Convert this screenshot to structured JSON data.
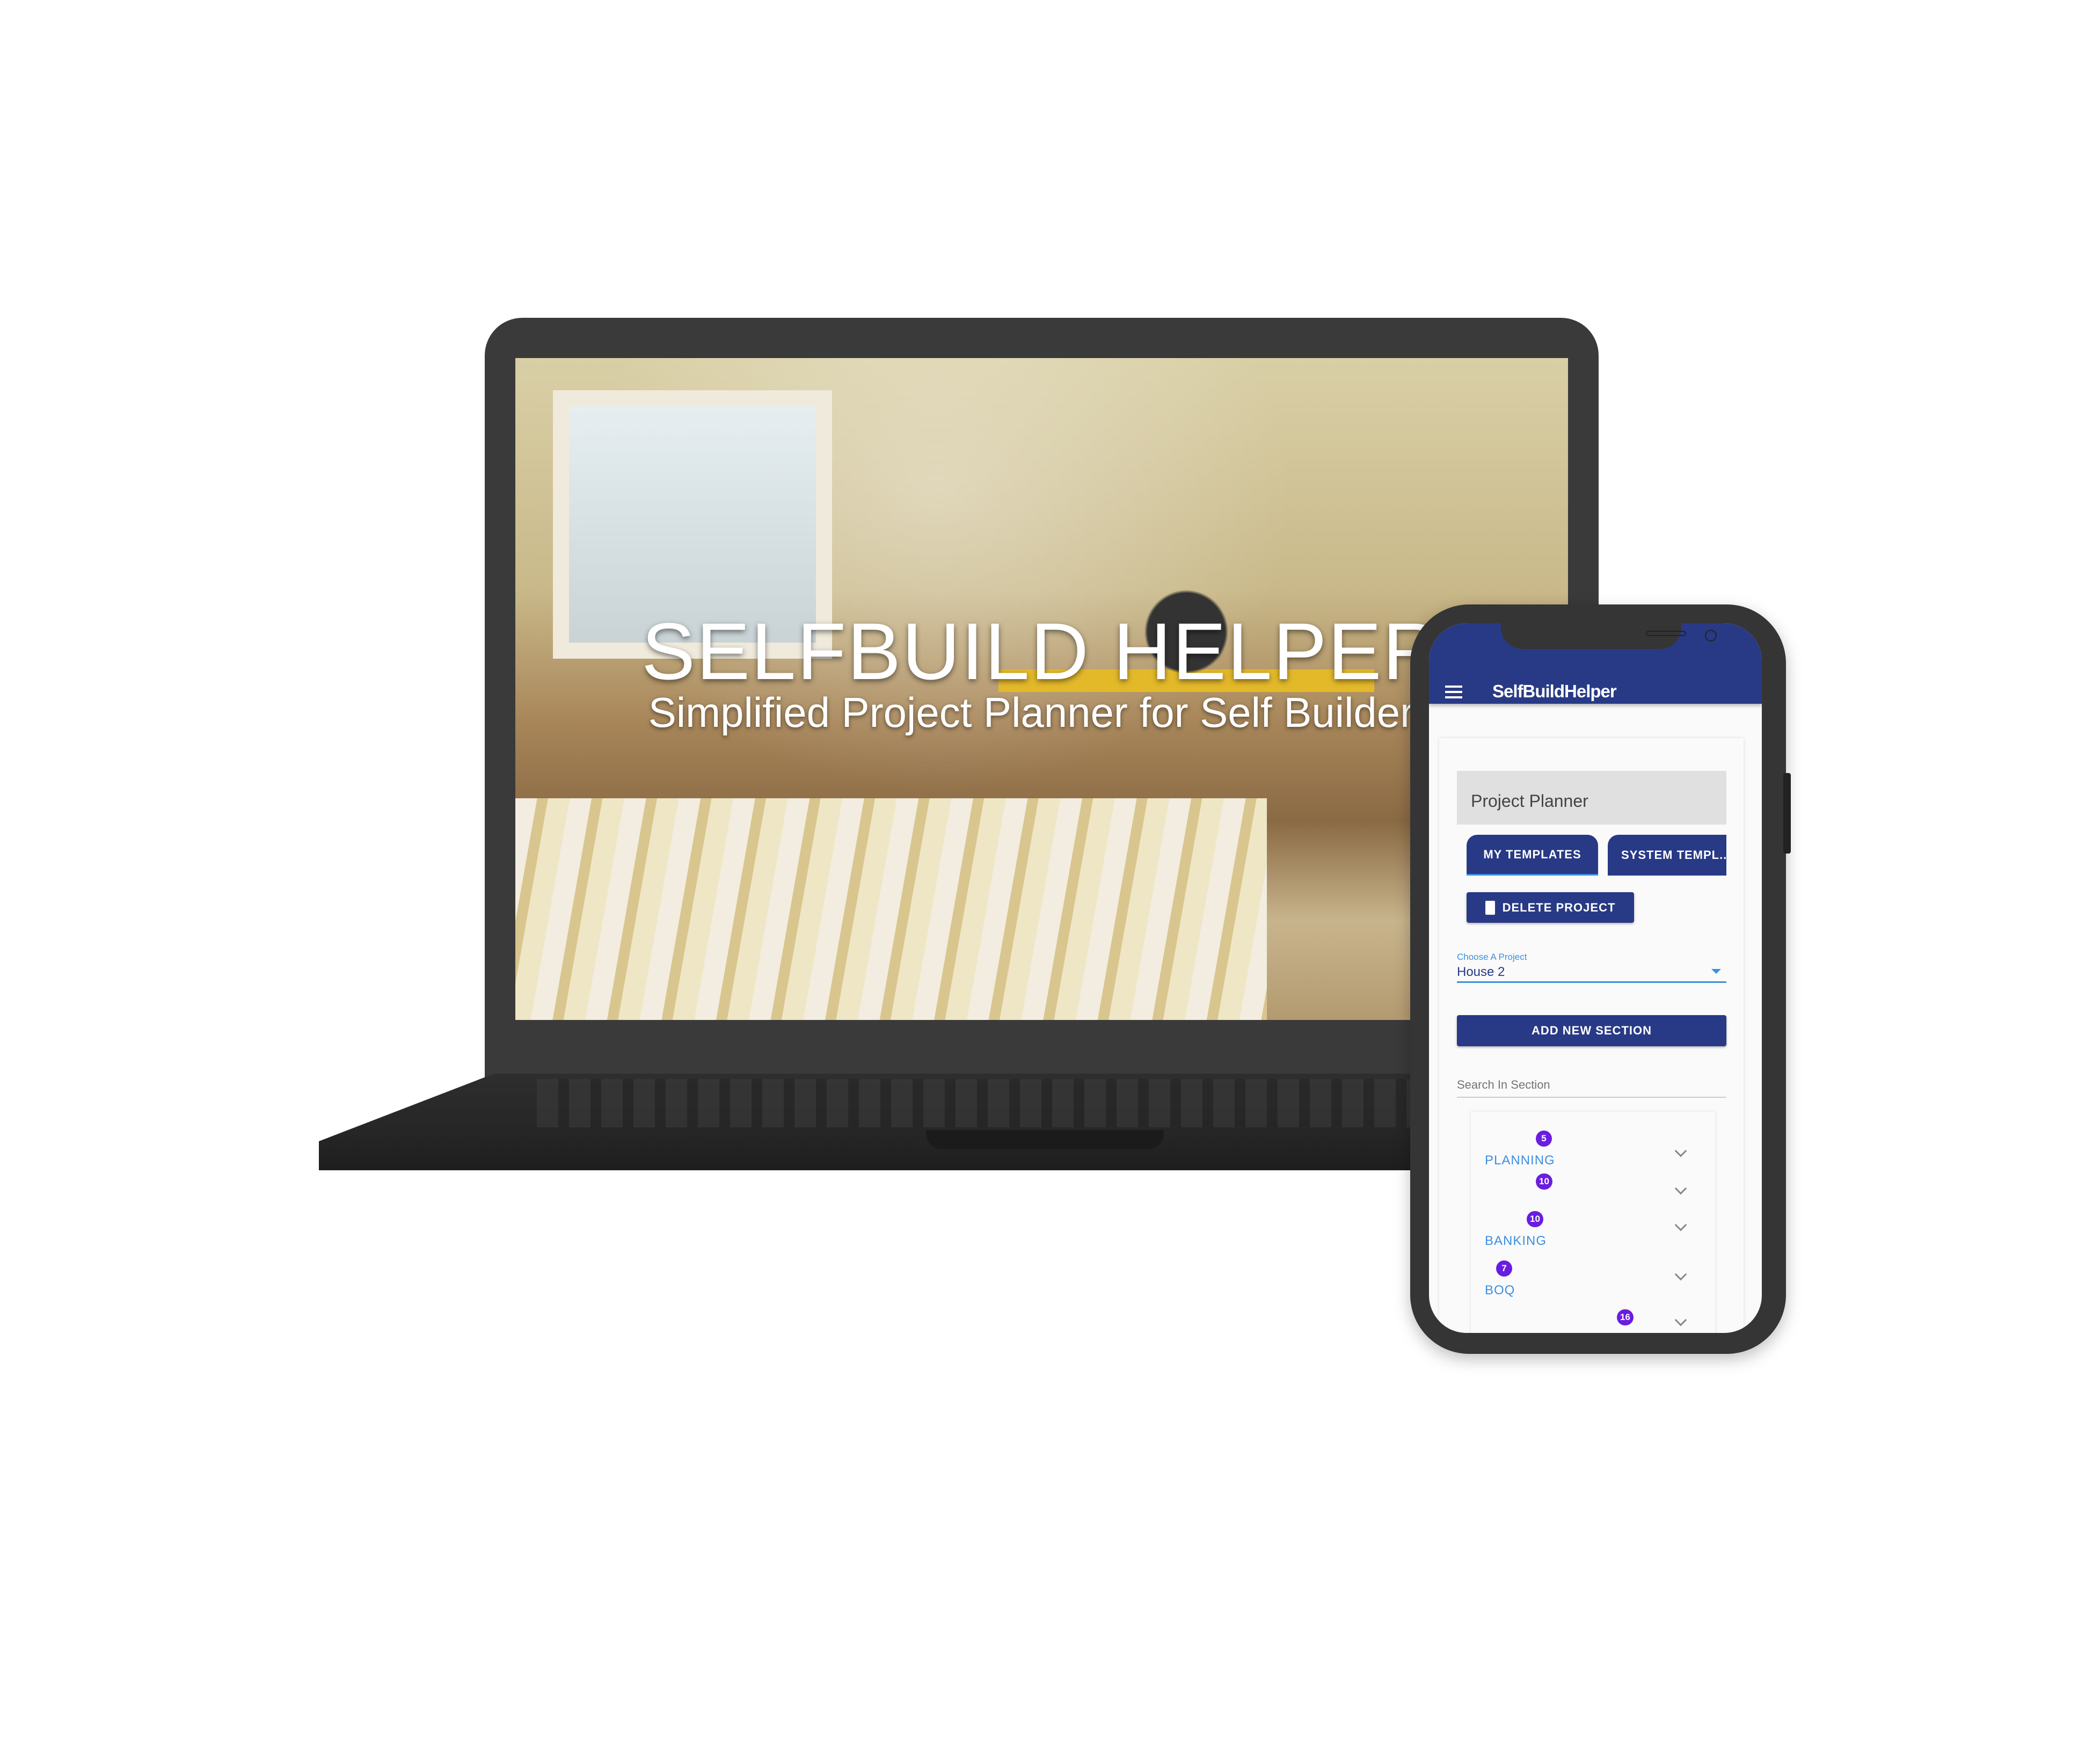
{
  "laptop": {
    "hero_title": "SELFBUILD HELPER",
    "hero_subtitle": "Simplified Project Planner for Self Builders"
  },
  "phone": {
    "app_title": "SelfBuildHelper",
    "page_heading": "Project Planner",
    "tabs": [
      {
        "label": "MY TEMPLATES",
        "active": true
      },
      {
        "label": "SYSTEM TEMPL..."
      }
    ],
    "delete_button": "DELETE PROJECT",
    "project_select": {
      "label": "Choose A Project",
      "value": "House 2"
    },
    "add_section_button": "ADD NEW SECTION",
    "search_placeholder": "Search In Section",
    "sections": [
      {
        "label": "PLANNING",
        "count": "5"
      },
      {
        "label": "",
        "count": "10"
      },
      {
        "label": "BANKING",
        "count": "10"
      },
      {
        "label": "BOQ",
        "count": "7"
      },
      {
        "label": "",
        "count": "16"
      }
    ],
    "colors": {
      "primary": "#283a85",
      "accent": "#3d8fe0",
      "badge": "#6a1de0"
    }
  }
}
